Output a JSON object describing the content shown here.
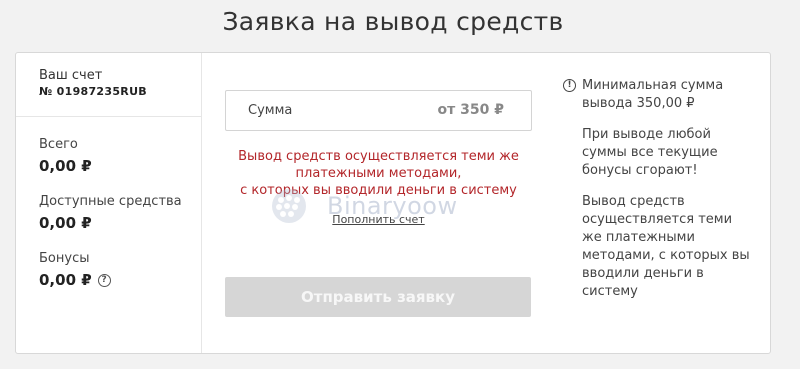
{
  "page": {
    "title": "Заявка на вывод средств"
  },
  "account": {
    "label": "Ваш счет",
    "number": "№ 01987235RUB"
  },
  "balances": {
    "total_label": "Всего",
    "total_value": "0,00 ₽",
    "available_label": "Доступные средства",
    "available_value": "0,00 ₽",
    "bonus_label": "Бонусы",
    "bonus_value": "0,00 ₽"
  },
  "icons": {
    "help": "question-circle-icon",
    "info": "info-circle-icon"
  },
  "form": {
    "amount_placeholder": "Сумма",
    "amount_min": "от 350 ₽",
    "warning_line1": "Вывод средств осуществляется теми же",
    "warning_line2": "платежными методами,",
    "warning_line3": "с которых вы вводили деньги в систему",
    "topup_link": "Пополнить счет",
    "submit_label": "Отправить заявку"
  },
  "watermark": {
    "text": "Binaryoow"
  },
  "info": {
    "min_amount": "Минимальная сумма вывода 350,00 ₽",
    "bonus_note": "При выводе любой суммы все текущие бонусы сгорают!",
    "method_note": "Вывод средств осуществляется теми же платежными методами, с которых вы вводили деньги в систему"
  },
  "colors": {
    "warning": "#b3262a",
    "button_disabled": "#d6d6d6",
    "background": "#f2f2f2"
  }
}
